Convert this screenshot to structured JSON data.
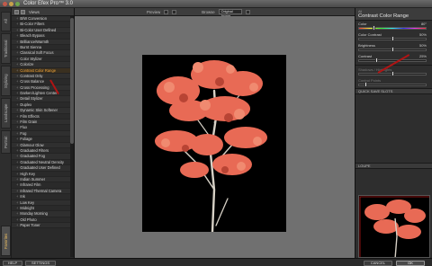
{
  "window": {
    "title": "Color Efex Pro™ 3.0"
  },
  "left_tabs": [
    "All",
    "Traditional",
    "Stylizing",
    "Landscape",
    "Portrait",
    "Favorites"
  ],
  "filter_header": {
    "label": "Views"
  },
  "filters": [
    "B/W Conversion",
    "Bi-Color Filters",
    "Bi-Color User Defined",
    "Bleach Bypass",
    "Brilliance/Warmth",
    "Burnt Sienna",
    "Classical Soft Focus",
    "Color Stylizer",
    "Colorize",
    "Contrast Color Range",
    "Contrast Only",
    "Cross Balance",
    "Cross Processing",
    "Darken/Lighten Center",
    "Detail Stylizer",
    "Duplex",
    "Dynamic Skin Softener",
    "Film Effects",
    "Film Grain",
    "Flux",
    "Fog",
    "Foliage",
    "Glamour Glow",
    "Graduated Filters",
    "Graduated Fog",
    "Graduated Neutral Density",
    "Graduated User Defined",
    "High Key",
    "Indian Summer",
    "Infrared Film",
    "Infrared Thermal Camera",
    "Ink",
    "Low Key",
    "Midnight",
    "Monday Morning",
    "Old Photo",
    "Paper Toner"
  ],
  "active_filter_index": 9,
  "toolbar": {
    "preview_label": "Preview",
    "mode_label": "Browse",
    "mode_value": "Original Image"
  },
  "right_panel": {
    "subtitle": "All",
    "title": "Contrast Color Range",
    "controls": [
      {
        "label": "Color",
        "value": "80°",
        "level": 0.22,
        "rainbow": true
      },
      {
        "label": "Color Contrast",
        "value": "50%",
        "level": 0.5
      },
      {
        "label": "Brightness",
        "value": "50%",
        "level": 0.5
      },
      {
        "label": "Contrast",
        "value": "25%",
        "level": 0.25
      },
      {
        "label": "Shadows / Highlights",
        "value": "",
        "level": 0.5,
        "dim": true
      },
      {
        "label": "Control Points",
        "value": "",
        "level": 0.1,
        "dim": true
      }
    ],
    "section_quick_save": "QUICK SAVE SLOTS",
    "section_loupe": "LOUPE"
  },
  "bottom": {
    "help": "HELP",
    "settings": "SETTINGS",
    "cancel": "CANCEL",
    "ok": "OK"
  },
  "colors": {
    "accent_active": "#f2a53a",
    "foliage": "#e86a55",
    "arrow": "#b01414"
  }
}
